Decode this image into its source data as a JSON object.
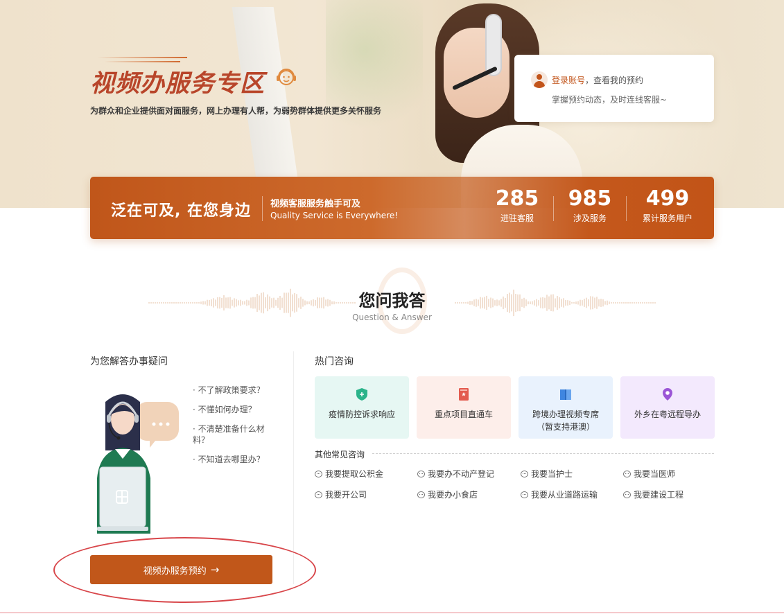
{
  "hero": {
    "title": "视频办服务专区",
    "subtitle": "为群众和企业提供面对面服务，网上办理有人帮，为弱势群体提供更多关怀服务"
  },
  "login_card": {
    "link": "登录账号",
    "line1_rest": "，查看我的预约",
    "line2": "掌握预约动态，及时连线客服~"
  },
  "stats_bar": {
    "slogan": "泛在可及, 在您身边",
    "slogan_cn": "视频客服服务触手可及",
    "slogan_en": "Quality Service is Everywhere!",
    "stats": [
      {
        "value": "285",
        "label": "进驻客服"
      },
      {
        "value": "985",
        "label": "涉及服务"
      },
      {
        "value": "499",
        "label": "累计服务用户"
      }
    ]
  },
  "qa": {
    "title": "您问我答",
    "subtitle": "Question & Answer"
  },
  "left": {
    "title": "为您解答办事疑问",
    "questions": [
      "· 不了解政策要求？",
      "· 不懂如何办理？",
      "· 不清楚准备什么材料？",
      "· 不知道去哪里办？"
    ],
    "button_label": "视频办服务预约",
    "button_arrow": "→"
  },
  "hot": {
    "title": "热门咨询",
    "cards": [
      {
        "label": "疫情防控诉求响应",
        "icon": "shield-plus-icon",
        "bg": "#e6f7f3",
        "color": "#2bb38a"
      },
      {
        "label": "重点项目直通车",
        "icon": "red-book-icon",
        "bg": "#fdeeea",
        "color": "#e35b4f"
      },
      {
        "label": "跨境办理视频专席（暂支持港澳）",
        "label_line1": "跨境办理视频专席",
        "label_line2": "（暂支持港澳）",
        "icon": "map-book-icon",
        "bg": "#e9f2fd",
        "color": "#3f86e0"
      },
      {
        "label": "外乡在粤远程导办",
        "icon": "location-pin-icon",
        "bg": "#f3e9fd",
        "color": "#9b55d6"
      }
    ]
  },
  "other": {
    "title": "其他常见咨询",
    "items": [
      "我要提取公积金",
      "我要办不动产登记",
      "我要当护士",
      "我要当医师",
      "我要开公司",
      "我要办小食店",
      "我要从业道路运输",
      "我要建设工程"
    ]
  },
  "colors": {
    "accent": "#c1571a",
    "title_red": "#b8452a",
    "annotation_oval": "#d8464a"
  }
}
